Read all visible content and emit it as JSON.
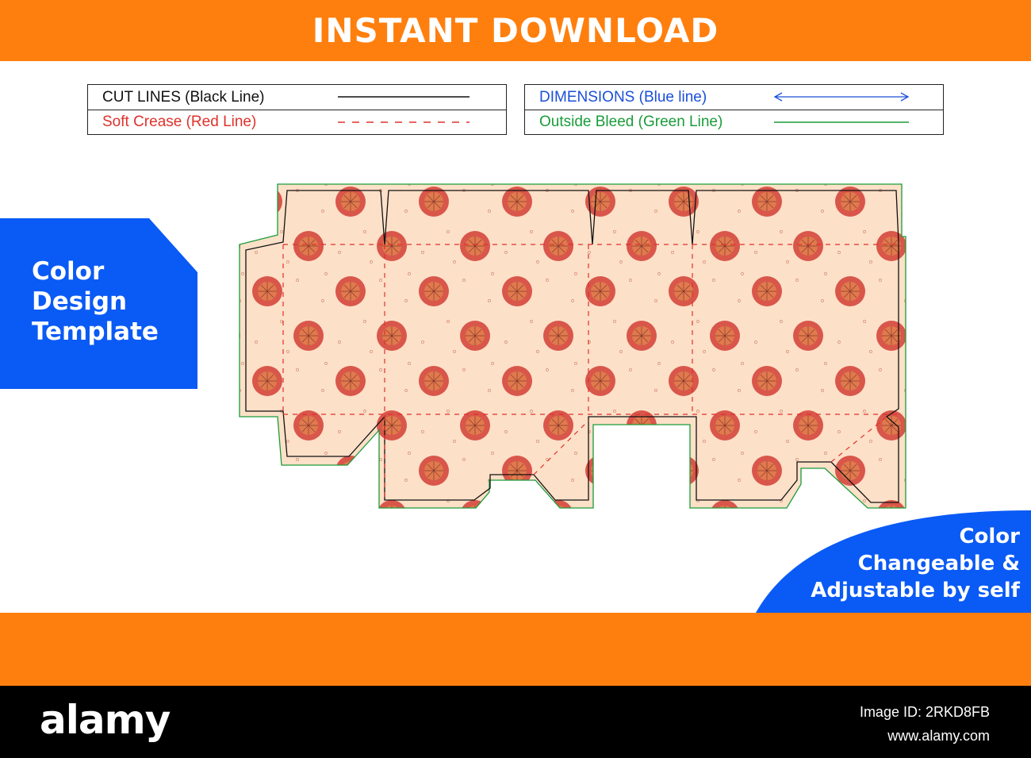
{
  "colors": {
    "orange": "#ff7f0e",
    "blue": "#0a5af5",
    "cut_line": "#111111",
    "crease": "#e0312b",
    "dimension": "#1a4fd8",
    "bleed": "#1a9c3a",
    "artwork_background": "#fde0c8",
    "artwork_dots": "#d9564a"
  },
  "header": {
    "title": "INSTANT DOWNLOAD"
  },
  "legend": {
    "left": [
      {
        "label": "CUT LINES (Black Line)",
        "color": "#111111",
        "style": "solid"
      },
      {
        "label": "Soft Crease (Red Line)",
        "color": "#e0312b",
        "style": "dashed"
      }
    ],
    "right": [
      {
        "label": "DIMENSIONS (Blue line)",
        "color": "#1a4fd8",
        "style": "arrow"
      },
      {
        "label": "Outside Bleed (Green Line)",
        "color": "#1a9c3a",
        "style": "solid"
      }
    ]
  },
  "side_panel": {
    "line1": "Color",
    "line2": "Design",
    "line3": "Template"
  },
  "corner_panel": {
    "line1": "Color",
    "line2": "Changeable &",
    "line3": "Adjustable by self"
  },
  "footer": {
    "brand": "alamy",
    "image_id": "Image ID: 2RKD8FB",
    "site": "www.alamy.com"
  }
}
